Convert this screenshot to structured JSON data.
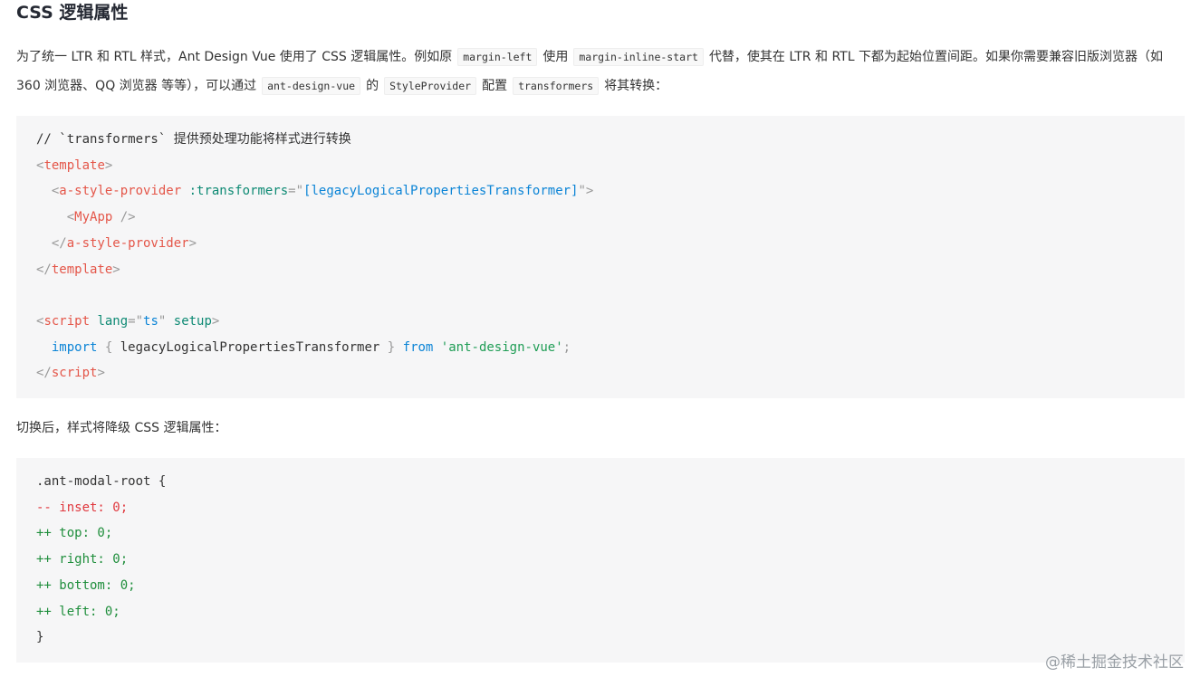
{
  "heading": "CSS 逻辑属性",
  "intro": {
    "t1": "为了统一 LTR 和 RTL 样式，Ant Design Vue 使用了 CSS 逻辑属性。例如原",
    "c1": "margin-left",
    "t2": "使用",
    "c2": "margin-inline-start",
    "t3": "代替，使其在 LTR 和 RTL 下都为起始位置间距。如果你需要兼容旧版浏览器（如 360 浏览器、QQ 浏览器 等等），可以通过",
    "c3": "ant-design-vue",
    "t4": "的",
    "c4": "StyleProvider",
    "t5": "配置",
    "c5": "transformers",
    "t6": "将其转换："
  },
  "code1": {
    "comment": "// `transformers` 提供预处理功能将样式进行转换",
    "template_open": "template",
    "provider": "a-style-provider",
    "attr": ":transformers",
    "attr_val": "[legacyLogicalPropertiesTransformer]",
    "myapp": "MyApp",
    "script": "script",
    "lang_attr": "lang",
    "lang_val": "ts",
    "setup": "setup",
    "import_kw": "import",
    "import_name": "legacyLogicalPropertiesTransformer",
    "from_kw": "from",
    "module": "'ant-design-vue'"
  },
  "after_text": "切换后，样式将降级 CSS 逻辑属性：",
  "code2": {
    "selector": ".ant-modal-root {",
    "l1": "-- inset: 0;",
    "l2": "++ top: 0;",
    "l3": "++ right: 0;",
    "l4": "++ bottom: 0;",
    "l5": "++ left: 0;",
    "close": "}"
  },
  "watermark": "@稀土掘金技术社区"
}
